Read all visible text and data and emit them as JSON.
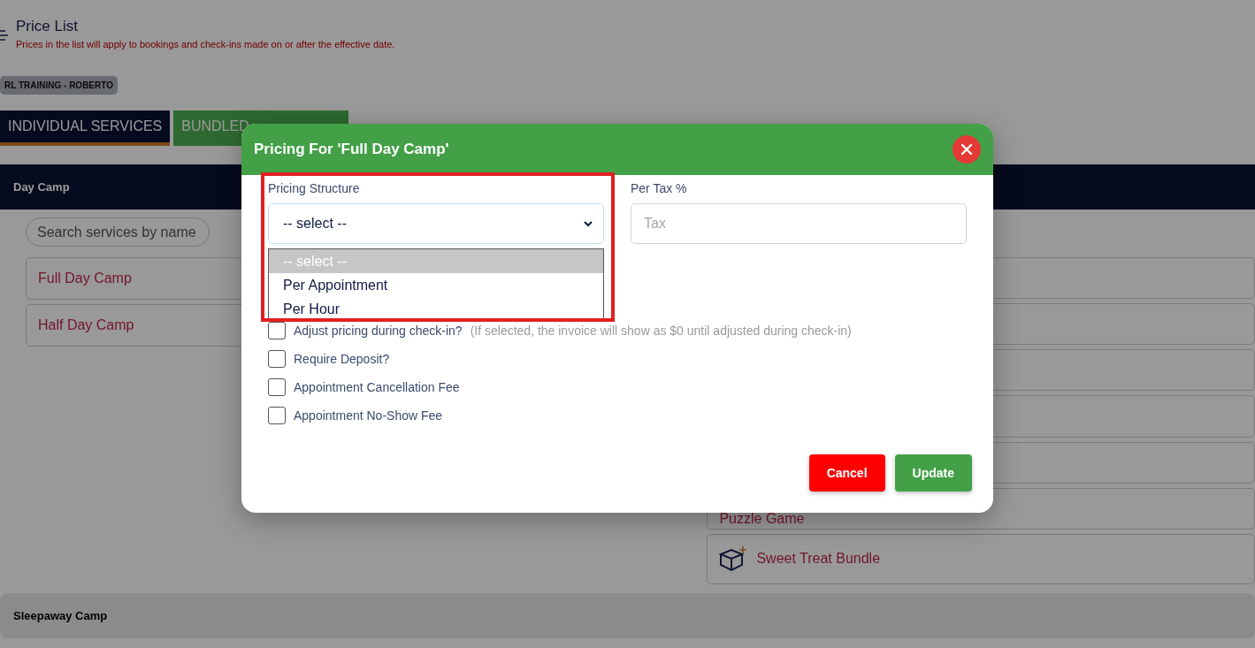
{
  "header": {
    "title": "Price List",
    "subtitle": "Prices in the list will apply to bookings and check-ins made on or after the effective date."
  },
  "badge": "RL TRAINING - ROBERTO",
  "tabs": [
    {
      "label": "INDIVIDUAL SERVICES",
      "selected": true
    },
    {
      "label": "BUNDLED",
      "selected": false
    }
  ],
  "sections": [
    {
      "title": "Day Camp",
      "expanded": true,
      "search": {
        "placeholder": "Search services by name"
      },
      "services": [
        {
          "label": "Full Day Camp"
        },
        {
          "label": "Half Day Camp"
        }
      ],
      "bundles": [
        {
          "label": "Puzzle Game",
          "kind": "plain"
        },
        {
          "label": "Sweet Treat Bundle",
          "kind": "bundle"
        }
      ]
    },
    {
      "title": "Sleepaway Camp",
      "expanded": false
    }
  ],
  "modal": {
    "title": "Pricing For 'Full Day Camp'",
    "fields": [
      {
        "kind": "select",
        "label": "Pricing Structure",
        "value": "-- select --",
        "highlighted": true,
        "expanded": true,
        "options": [
          {
            "label": "-- select --",
            "selected": true
          },
          {
            "label": "Per Appointment",
            "selected": false
          },
          {
            "label": "Per Hour",
            "selected": false
          }
        ]
      },
      {
        "kind": "input",
        "label": "Per Tax %",
        "placeholder": "Tax"
      }
    ],
    "checkboxes": [
      {
        "label": "Adjust pricing during check-in?",
        "note": "(If selected, the invoice will show as $0 until adjusted during check-in)",
        "checked": false
      },
      {
        "label": "Require Deposit?",
        "checked": false
      },
      {
        "label": "Appointment Cancellation Fee",
        "checked": false
      },
      {
        "label": "Appointment No-Show Fee",
        "checked": false
      }
    ],
    "buttons": [
      {
        "label": "Cancel",
        "kind": "cancel"
      },
      {
        "label": "Update",
        "kind": "primary"
      }
    ]
  }
}
